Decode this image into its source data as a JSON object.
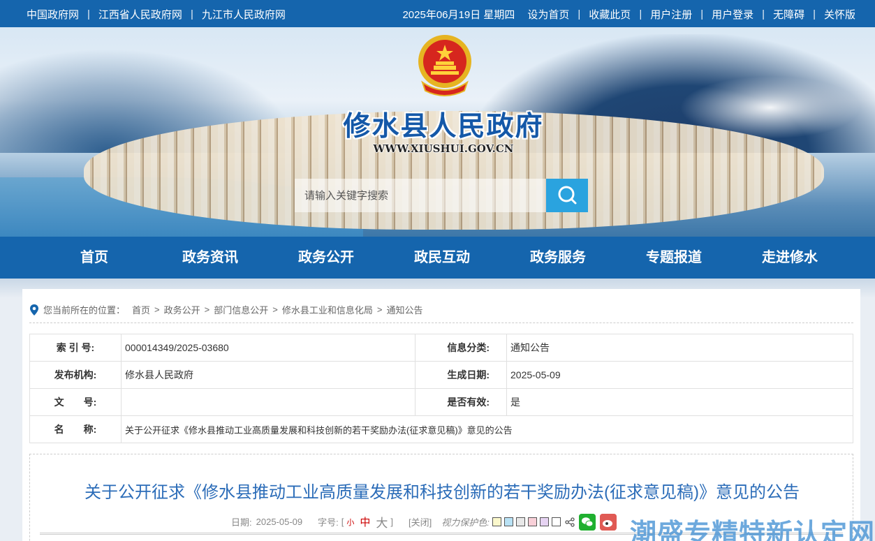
{
  "topbar": {
    "links_left": [
      "中国政府网",
      "江西省人民政府网",
      "九江市人民政府网"
    ],
    "date": "2025年06月19日 星期四",
    "links_right": [
      "设为首页",
      "收藏此页",
      "用户注册",
      "用户登录",
      "无障碍",
      "关怀版"
    ],
    "separator": "|"
  },
  "banner": {
    "site_title": "修水县人民政府",
    "site_url": "WWW.XIUSHUI.GOV.CN"
  },
  "search": {
    "placeholder": "请输入关键字搜索"
  },
  "nav": [
    "首页",
    "政务资讯",
    "政务公开",
    "政民互动",
    "政务服务",
    "专题报道",
    "走进修水"
  ],
  "breadcrumb": {
    "prefix": "您当前所在的位置：",
    "items": [
      "首页",
      "政务公开",
      "部门信息公开",
      "修水县工业和信息化局",
      "通知公告"
    ],
    "separator": ">"
  },
  "meta": {
    "index_label": "索 引 号:",
    "index_value": "000014349/2025-03680",
    "category_label": "信息分类:",
    "category_value": "通知公告",
    "publisher_label": "发布机构:",
    "publisher_value": "修水县人民政府",
    "created_label": "生成日期:",
    "created_value": "2025-05-09",
    "docno_label": "文　　号:",
    "docno_value": "",
    "valid_label": "是否有效:",
    "valid_value": "是",
    "name_label": "名　　称:",
    "name_value": "关于公开征求《修水县推动工业高质量发展和科技创新的若干奖励办法(征求意见稿)》意见的公告"
  },
  "article": {
    "title": "关于公开征求《修水县推动工业高质量发展和科技创新的若干奖励办法(征求意见稿)》意见的公告",
    "date_label": "日期:",
    "date_value": "2025-05-09",
    "fontsize_label": "字号:",
    "bracket_open": "[",
    "bracket_close": "]",
    "font_small": "小",
    "font_mid": "中",
    "font_big": "大",
    "close_label": "[关闭]",
    "eye_label": "视力保护色:",
    "swatches": [
      "#fbf8cc",
      "#b9e2f5",
      "#e8e8e8",
      "#f8d0d8",
      "#e6d3f2",
      "#ffffff"
    ]
  },
  "watermark": "潮盛专精特新认定网",
  "colors": {
    "primary": "#1565ad",
    "accent": "#2aa3df",
    "title": "#2b6cb8"
  }
}
